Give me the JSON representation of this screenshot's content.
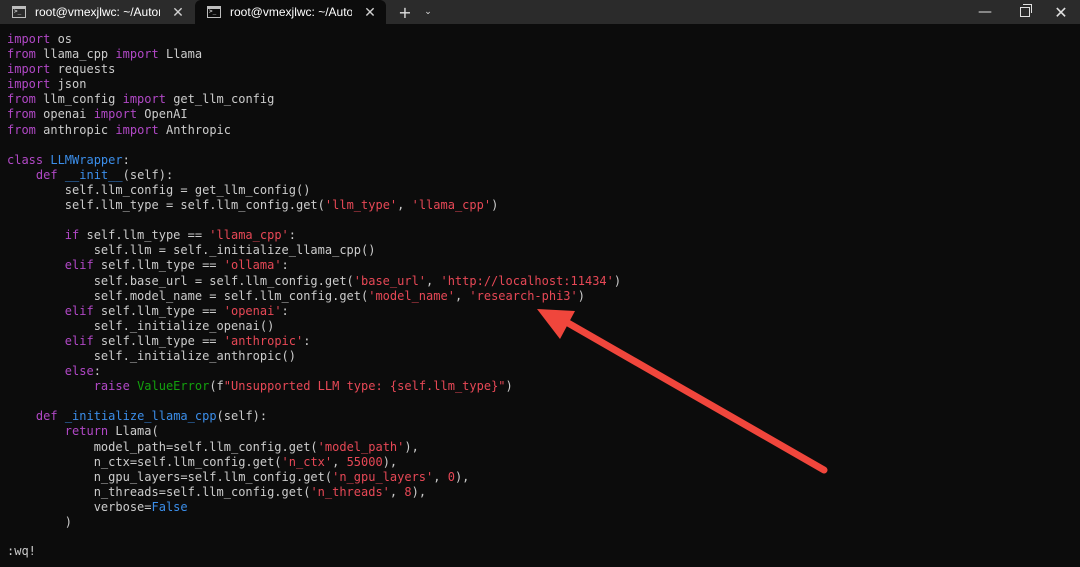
{
  "tabs": [
    {
      "title": "root@vmexjlwc: ~/Automated",
      "close_label": "✕"
    },
    {
      "title": "root@vmexjlwc: ~/Automated",
      "close_label": "✕"
    }
  ],
  "tabbar": {
    "new_tab_label": "+",
    "dropdown_label": "⌄"
  },
  "window_controls": {
    "minimize_label": "—",
    "close_label": "✕"
  },
  "code_lines": [
    [
      {
        "t": "import",
        "c": "kw"
      },
      {
        "t": " os"
      }
    ],
    [
      {
        "t": "from",
        "c": "kw"
      },
      {
        "t": " llama_cpp "
      },
      {
        "t": "import",
        "c": "kw"
      },
      {
        "t": " Llama"
      }
    ],
    [
      {
        "t": "import",
        "c": "kw"
      },
      {
        "t": " requests"
      }
    ],
    [
      {
        "t": "import",
        "c": "kw"
      },
      {
        "t": " json"
      }
    ],
    [
      {
        "t": "from",
        "c": "kw"
      },
      {
        "t": " llm_config "
      },
      {
        "t": "import",
        "c": "kw"
      },
      {
        "t": " get_llm_config"
      }
    ],
    [
      {
        "t": "from",
        "c": "kw"
      },
      {
        "t": " openai "
      },
      {
        "t": "import",
        "c": "kw"
      },
      {
        "t": " OpenAI"
      }
    ],
    [
      {
        "t": "from",
        "c": "kw"
      },
      {
        "t": " anthropic "
      },
      {
        "t": "import",
        "c": "kw"
      },
      {
        "t": " Anthropic"
      }
    ],
    [],
    [
      {
        "t": "class",
        "c": "kw"
      },
      {
        "t": " "
      },
      {
        "t": "LLMWrapper",
        "c": "def"
      },
      {
        "t": ":"
      }
    ],
    [
      {
        "t": "    "
      },
      {
        "t": "def",
        "c": "kw"
      },
      {
        "t": " "
      },
      {
        "t": "__init__",
        "c": "def"
      },
      {
        "t": "(self):"
      }
    ],
    [
      {
        "t": "        self.llm_config = get_llm_config()"
      }
    ],
    [
      {
        "t": "        self.llm_type = self.llm_config.get("
      },
      {
        "t": "'llm_type'",
        "c": "str"
      },
      {
        "t": ", "
      },
      {
        "t": "'llama_cpp'",
        "c": "str"
      },
      {
        "t": ")"
      }
    ],
    [],
    [
      {
        "t": "        "
      },
      {
        "t": "if",
        "c": "kw"
      },
      {
        "t": " self.llm_type == "
      },
      {
        "t": "'llama_cpp'",
        "c": "str"
      },
      {
        "t": ":"
      }
    ],
    [
      {
        "t": "            self.llm = self._initialize_llama_cpp()"
      }
    ],
    [
      {
        "t": "        "
      },
      {
        "t": "elif",
        "c": "kw"
      },
      {
        "t": " self.llm_type == "
      },
      {
        "t": "'ollama'",
        "c": "str"
      },
      {
        "t": ":"
      }
    ],
    [
      {
        "t": "            self.base_url = self.llm_config.get("
      },
      {
        "t": "'base_url'",
        "c": "str"
      },
      {
        "t": ", "
      },
      {
        "t": "'http://localhost:11434'",
        "c": "str"
      },
      {
        "t": ")"
      }
    ],
    [
      {
        "t": "            self.model_name = self.llm_config.get("
      },
      {
        "t": "'model_name'",
        "c": "str"
      },
      {
        "t": ", "
      },
      {
        "t": "'research-phi3'",
        "c": "str"
      },
      {
        "t": ")"
      }
    ],
    [
      {
        "t": "        "
      },
      {
        "t": "elif",
        "c": "kw"
      },
      {
        "t": " self.llm_type == "
      },
      {
        "t": "'openai'",
        "c": "str"
      },
      {
        "t": ":"
      }
    ],
    [
      {
        "t": "            self._initialize_openai()"
      }
    ],
    [
      {
        "t": "        "
      },
      {
        "t": "elif",
        "c": "kw"
      },
      {
        "t": " self.llm_type == "
      },
      {
        "t": "'anthropic'",
        "c": "str"
      },
      {
        "t": ":"
      }
    ],
    [
      {
        "t": "            self._initialize_anthropic()"
      }
    ],
    [
      {
        "t": "        "
      },
      {
        "t": "else",
        "c": "kw"
      },
      {
        "t": ":"
      }
    ],
    [
      {
        "t": "            "
      },
      {
        "t": "raise",
        "c": "kw"
      },
      {
        "t": " "
      },
      {
        "t": "ValueError",
        "c": "err"
      },
      {
        "t": "(f"
      },
      {
        "t": "\"Unsupported LLM type: {self.llm_type}\"",
        "c": "str"
      },
      {
        "t": ")"
      }
    ],
    [],
    [
      {
        "t": "    "
      },
      {
        "t": "def",
        "c": "kw"
      },
      {
        "t": " "
      },
      {
        "t": "_initialize_llama_cpp",
        "c": "def"
      },
      {
        "t": "(self):"
      }
    ],
    [
      {
        "t": "        "
      },
      {
        "t": "return",
        "c": "kw"
      },
      {
        "t": " Llama("
      }
    ],
    [
      {
        "t": "            model_path=self.llm_config.get("
      },
      {
        "t": "'model_path'",
        "c": "str"
      },
      {
        "t": "),"
      }
    ],
    [
      {
        "t": "            n_ctx=self.llm_config.get("
      },
      {
        "t": "'n_ctx'",
        "c": "str"
      },
      {
        "t": ", "
      },
      {
        "t": "55000",
        "c": "num"
      },
      {
        "t": "),"
      }
    ],
    [
      {
        "t": "            n_gpu_layers=self.llm_config.get("
      },
      {
        "t": "'n_gpu_layers'",
        "c": "str"
      },
      {
        "t": ", "
      },
      {
        "t": "0",
        "c": "num"
      },
      {
        "t": "),"
      }
    ],
    [
      {
        "t": "            n_threads=self.llm_config.get("
      },
      {
        "t": "'n_threads'",
        "c": "str"
      },
      {
        "t": ", "
      },
      {
        "t": "8",
        "c": "num"
      },
      {
        "t": "),"
      }
    ],
    [
      {
        "t": "            verbose="
      },
      {
        "t": "False",
        "c": "def"
      }
    ],
    [
      {
        "t": "        )"
      }
    ]
  ],
  "command_line": ":wq!",
  "colors": {
    "keyword": "#b148c6",
    "definition": "#3b8eea",
    "string": "#e74856",
    "exception": "#13a10e",
    "text": "#cccccc",
    "background": "#0c0c0c",
    "annotation_arrow": "#f0463c"
  }
}
